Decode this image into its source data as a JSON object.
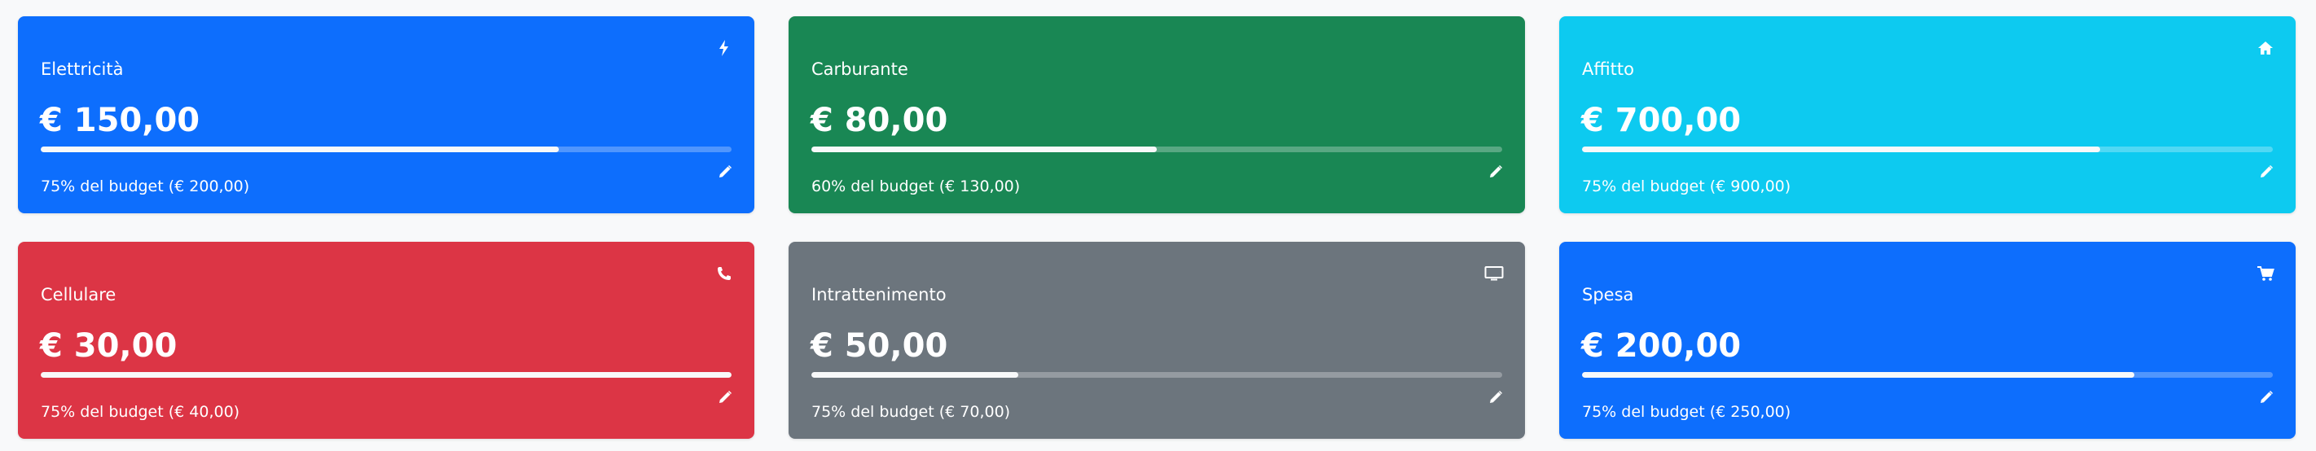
{
  "cards": [
    {
      "category": "Elettricità",
      "amount": "€ 150,00",
      "budget_text": "75% del budget (€ 200,00)",
      "progress": 0.75,
      "color": "#0d6efd",
      "icon": "bolt-icon"
    },
    {
      "category": "Carburante",
      "amount": "€ 80,00",
      "budget_text": "60% del budget (€ 130,00)",
      "progress": 0.5,
      "color": "#198754",
      "icon": "none"
    },
    {
      "category": "Affitto",
      "amount": "€ 700,00",
      "budget_text": "75% del budget (€ 900,00)",
      "progress": 0.75,
      "color": "#0dcaf0",
      "icon": "home-icon"
    },
    {
      "category": "Cellulare",
      "amount": "€ 30,00",
      "budget_text": "75% del budget (€ 40,00)",
      "progress": 1.0,
      "color": "#dc3545",
      "icon": "phone-icon"
    },
    {
      "category": "Intrattenimento",
      "amount": "€ 50,00",
      "budget_text": "75% del budget (€ 70,00)",
      "progress": 0.3,
      "color": "#6c757d",
      "icon": "monitor-icon"
    },
    {
      "category": "Spesa",
      "amount": "€ 200,00",
      "budget_text": "75% del budget (€ 250,00)",
      "progress": 0.8,
      "color": "#0d6efd",
      "icon": "cart-icon"
    }
  ]
}
